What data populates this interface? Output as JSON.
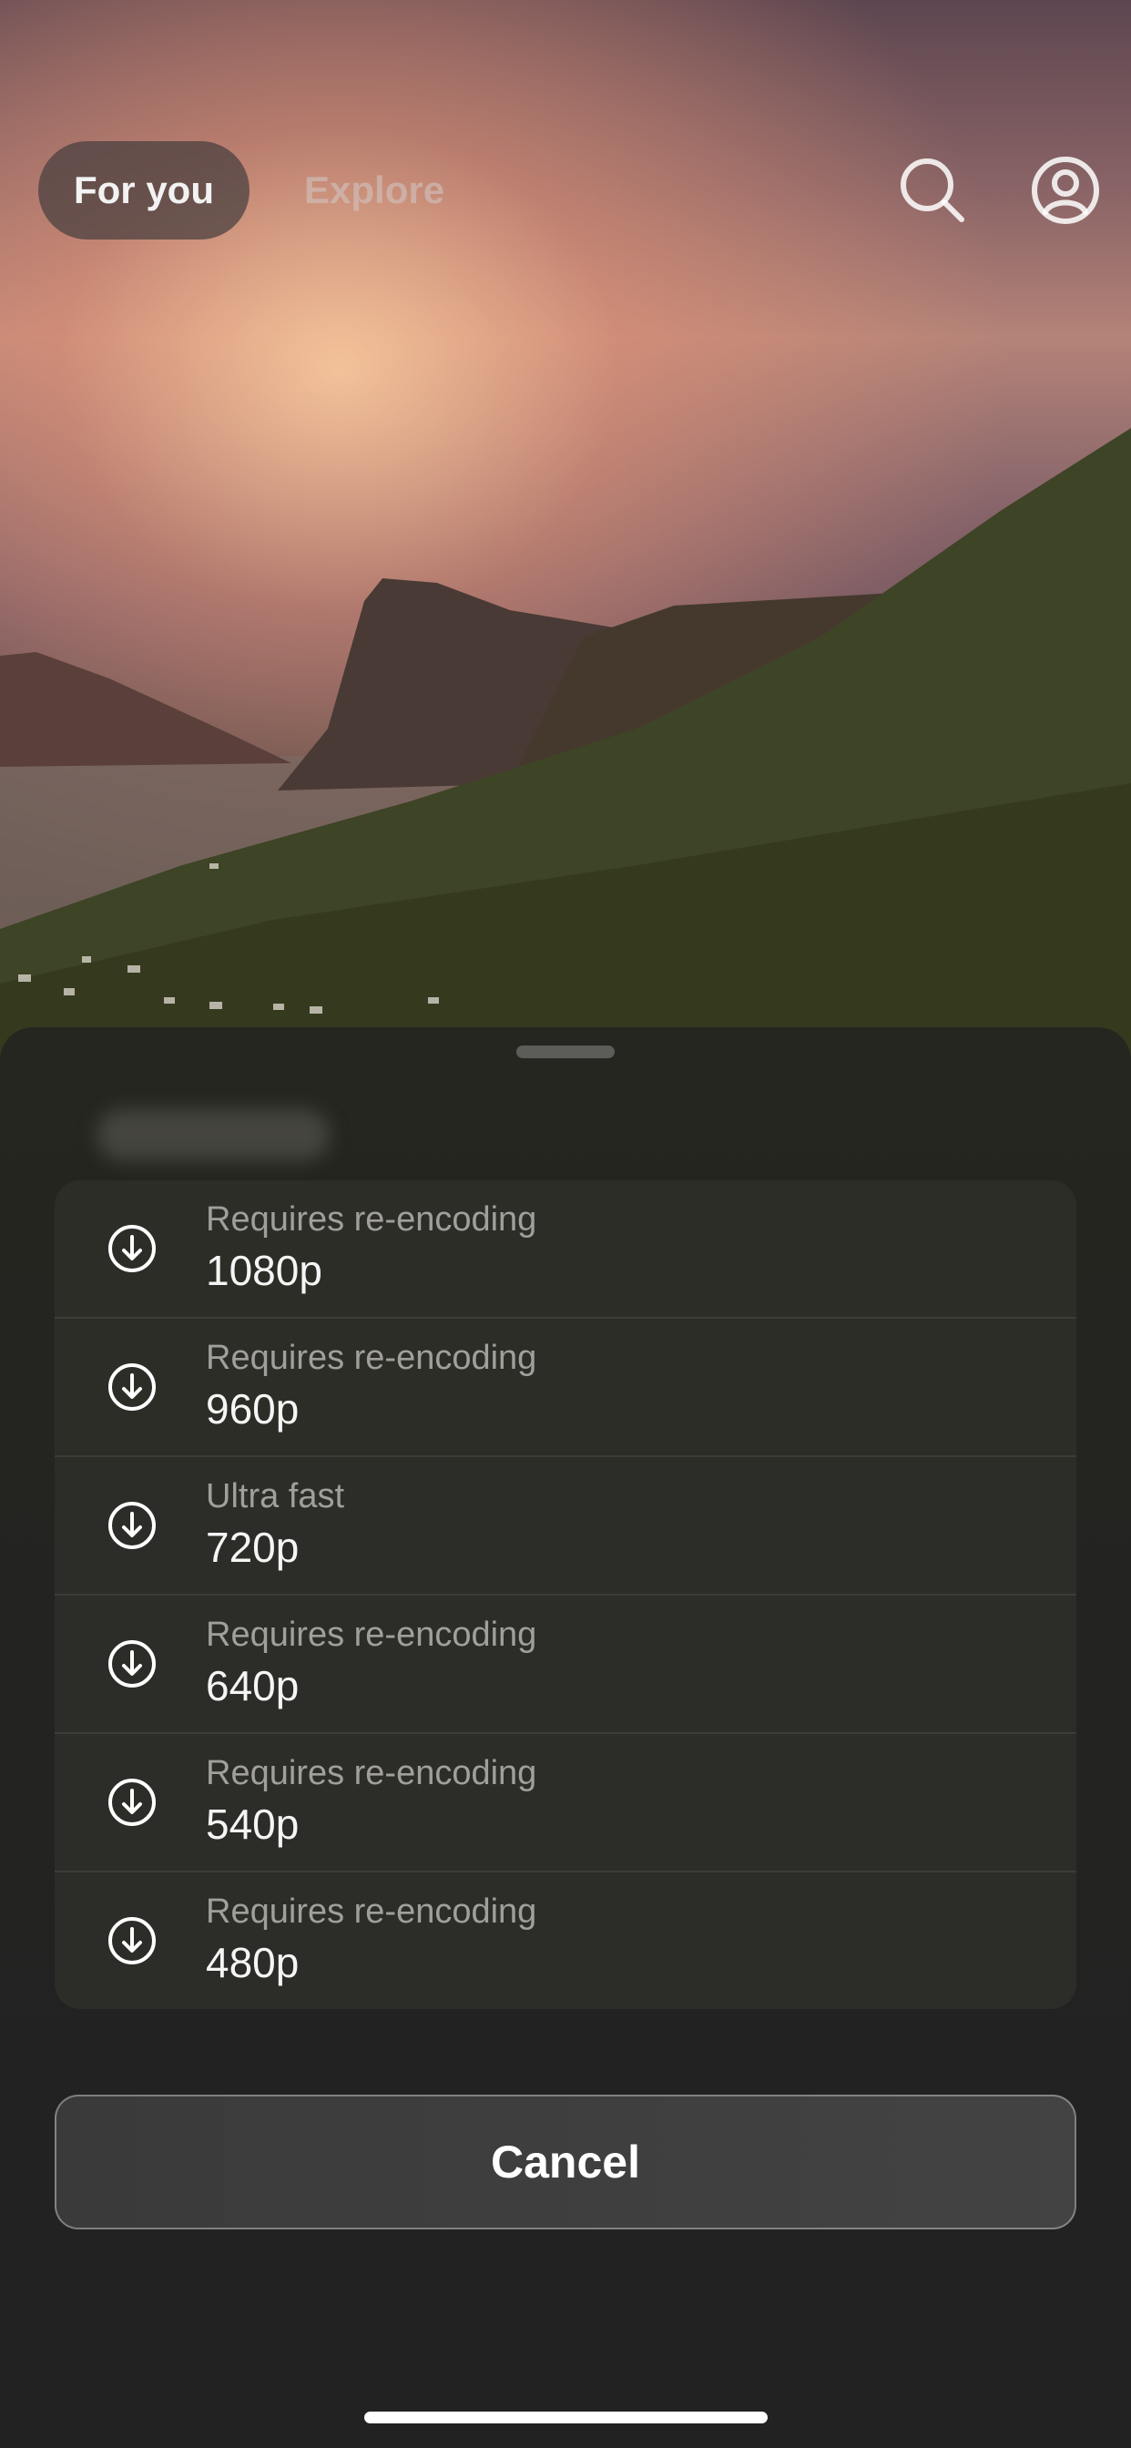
{
  "header": {
    "tabs": [
      {
        "label": "For you",
        "active": true
      },
      {
        "label": "Explore",
        "active": false
      }
    ],
    "search_icon": "search-icon",
    "profile_icon": "profile-icon"
  },
  "sheet": {
    "options": [
      {
        "subtitle": "Requires re-encoding",
        "resolution": "1080p",
        "icon": "download-icon"
      },
      {
        "subtitle": "Requires re-encoding",
        "resolution": "960p",
        "icon": "download-icon"
      },
      {
        "subtitle": "Ultra fast",
        "resolution": "720p",
        "icon": "download-icon"
      },
      {
        "subtitle": "Requires re-encoding",
        "resolution": "640p",
        "icon": "download-icon"
      },
      {
        "subtitle": "Requires re-encoding",
        "resolution": "540p",
        "icon": "download-icon"
      },
      {
        "subtitle": "Requires re-encoding",
        "resolution": "480p",
        "icon": "download-icon"
      }
    ],
    "cancel_label": "Cancel"
  }
}
